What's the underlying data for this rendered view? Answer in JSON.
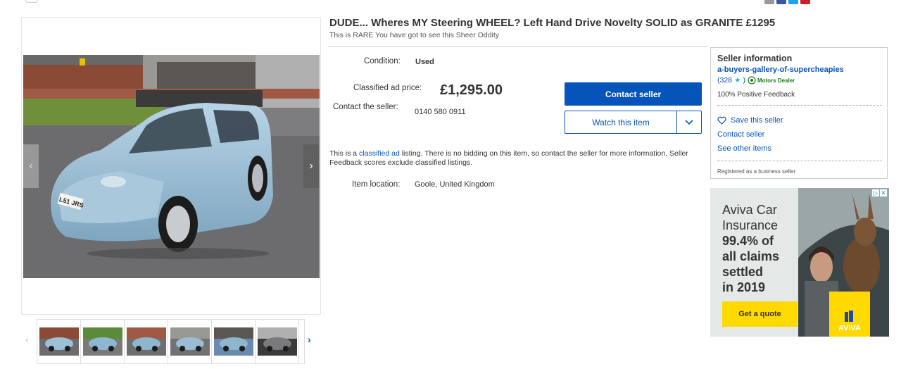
{
  "listing": {
    "title": "DUDE... Wheres MY Steering WHEEL? Left Hand Drive Novelty SOLID as GRANITE £1295",
    "subtitle": "This is RARE You have got to see this Sheer Oddity",
    "condition_label": "Condition:",
    "condition_value": "Used",
    "price_label": "Classified ad price:",
    "price_value": "£1,295.00",
    "contact_label": "Contact the seller:",
    "contact_phone": "0140 580 0911",
    "info_prefix": "This is a ",
    "info_link": "classified ad",
    "info_suffix": " listing. There is no bidding on this item, so contact the seller for more information. Seller Feedback scores exclude classified listings.",
    "location_label": "Item location:",
    "location_value": "Goole, United Kingdom"
  },
  "actions": {
    "contact_seller": "Contact seller",
    "watch_item": "Watch this item"
  },
  "gallery": {
    "plate": "L51 JRS",
    "thumb_count": 6
  },
  "seller": {
    "heading": "Seller information",
    "name": "a-buyers-gallery-of-supercheapies",
    "score": "(328",
    "score_close": ")",
    "badge": "Motors Dealer",
    "feedback": "100% Positive Feedback",
    "save_seller": "Save this seller",
    "contact_seller": "Contact seller",
    "other_items": "See other items",
    "registered": "Registered as a business seller"
  },
  "ad": {
    "line1": "Aviva Car",
    "line2": "Insurance",
    "line3": "99.4% of",
    "line4": "all claims",
    "line5": "settled",
    "line6": "in 2019",
    "cta": "Get a quote",
    "brand": "AVIVA"
  },
  "colors": {
    "link_blue": "#0654ba",
    "aviva_yellow": "#ffd900",
    "car_blue": "#8fb6cf"
  }
}
